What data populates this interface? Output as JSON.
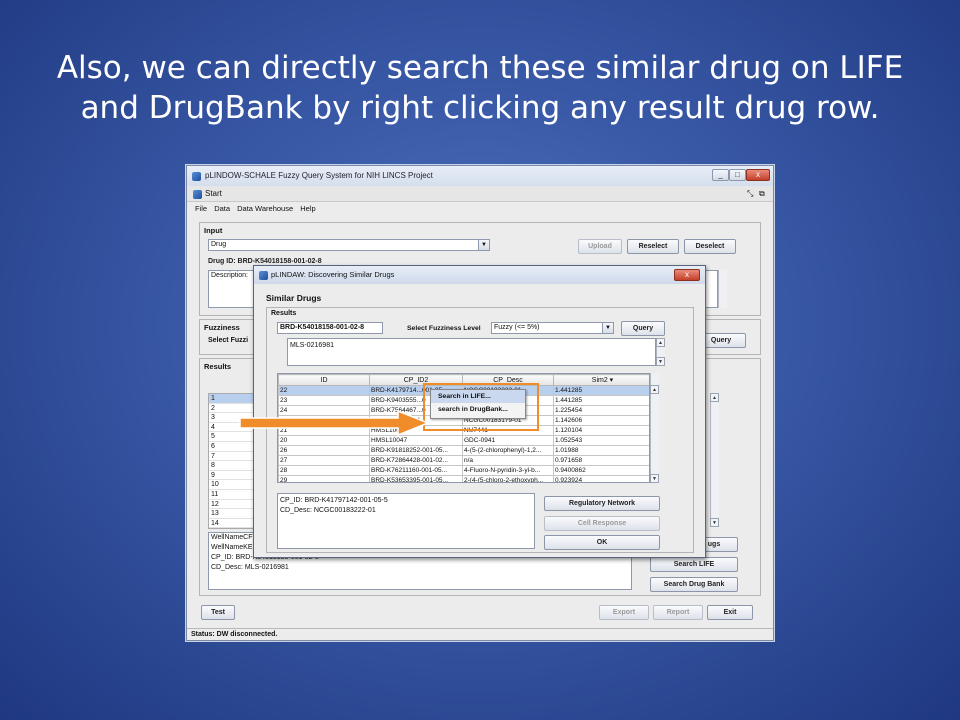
{
  "slide": {
    "title_line1": "Also, we can directly search these similar drug on LIFE",
    "title_line2": "and DrugBank by right clicking any result drug row."
  },
  "main_window": {
    "title": "pLINDOW-SCHALE Fuzzy Query System for NIH LINCS Project",
    "window_buttons": [
      "_",
      "□",
      "x"
    ],
    "frame_tab": "Start",
    "menu": [
      "File",
      "Data",
      "Data Warehouse",
      "Help"
    ],
    "input_panel": {
      "title": "Input",
      "combo_value": "Drug",
      "drug_id_label": "Drug ID: BRD-K54018158-001-02-8",
      "description_label": "Description:",
      "upload": "Upload",
      "reselect": "Reselect",
      "deselect": "Deselect"
    },
    "fuzziness_panel": {
      "title": "Fuzziness",
      "select_label": "Select Fuzzi",
      "query": "Query"
    },
    "results_panel": {
      "title": "Results",
      "row_numbers": [
        "1",
        "2",
        "3",
        "4",
        "5",
        "6",
        "7",
        "8",
        "9",
        "10",
        "11",
        "12",
        "13",
        "14"
      ],
      "detail_lines": [
        "WellNameCF",
        "WellNameKE",
        "CP_ID: BRD-K54018158-001-02-8",
        "CD_Desc: MLS-0216981"
      ],
      "buttons": {
        "similar_drugs": "ugs",
        "search_life": "Search LIFE",
        "search_drugbank": "Search Drug Bank"
      }
    },
    "bottom_buttons": {
      "test": "Test",
      "export": "Export",
      "report": "Report",
      "exit": "Exit"
    },
    "status": "Status: DW disconnected."
  },
  "dialog": {
    "title": "pLINDAW: Discovering Similar Drugs",
    "close": "x",
    "similar_drugs_label": "Similar Drugs",
    "results_label": "Results",
    "drug_id": "BRD-K54018158-001-02-8",
    "fuzziness_label": "Select Fuzziness Level",
    "fuzziness_value": "Fuzzy (<= 5%)",
    "query": "Query",
    "description": "MLS-0216981",
    "columns": [
      "ID",
      "CP_ID2",
      "CP_Desc",
      "Sim2 ▾"
    ],
    "rows": [
      [
        "22",
        "BRD-K4179714...001-05...",
        "NCGC00183222-01",
        "1.441285"
      ],
      [
        "23",
        "BRD-K9403555...0",
        "...B-0315...",
        "1.441285"
      ],
      [
        "24",
        "BRD-K7564467...0",
        "",
        "1.225454"
      ],
      [
        "25",
        "...BRD-...-001-04...",
        "NCGC00183179-01",
        "1.142606"
      ],
      [
        "21",
        "HMSL10041",
        "NU7441",
        "1.120104"
      ],
      [
        "20",
        "HMSL10047",
        "GDC-0941",
        "1.052543"
      ],
      [
        "26",
        "BRD-K91818252-001-05...",
        "4-(5-(2-chlorophenyl)-1,2...",
        "1.01988"
      ],
      [
        "27",
        "BRD-K72864428-001-02...",
        "n/a",
        "0.971658"
      ],
      [
        "28",
        "BRD-K76211160-001-05...",
        "4-Fluoro-N-pyridin-3-yl-b...",
        "0.9400862"
      ],
      [
        "29",
        "BRD-K53653395-001-05...",
        "2-(4-(5-chloro-2-ethoxyph...",
        "0.923924"
      ]
    ],
    "detail": [
      "CP_ID: BRD-K41797142-001-05-5",
      "CD_Desc: NCGC00183222-01"
    ],
    "regulatory_network": "Regulatory Network",
    "cell_response": "Cell Response",
    "ok": "OK"
  },
  "context_menu": {
    "items": [
      "Search in LIFE...",
      "search in DrugBank..."
    ]
  },
  "colors": {
    "slide_bg": "#3a5aa8",
    "highlight_box": "#f08c2a",
    "arrow": "#f08c2a"
  }
}
